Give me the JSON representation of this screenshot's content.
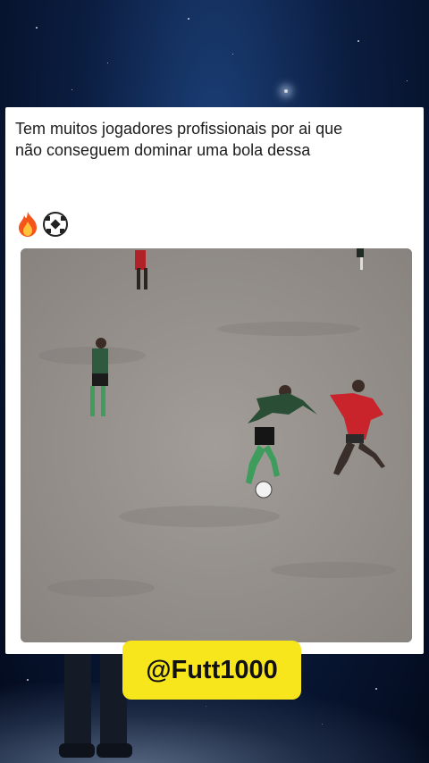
{
  "post": {
    "text": "Tem muitos jogadores profissionais por ai que não conseguem dominar uma bola dessa",
    "emojis": [
      "fire-emoji",
      "soccer-ball-emoji"
    ]
  },
  "video": {
    "description_icon": "soccer-video-frame"
  },
  "watermark": {
    "handle": "@Futt1000",
    "color": "#f7e61c"
  },
  "colors": {
    "background": "#0b1d40",
    "card": "#ffffff",
    "text": "#1c1c1c"
  }
}
